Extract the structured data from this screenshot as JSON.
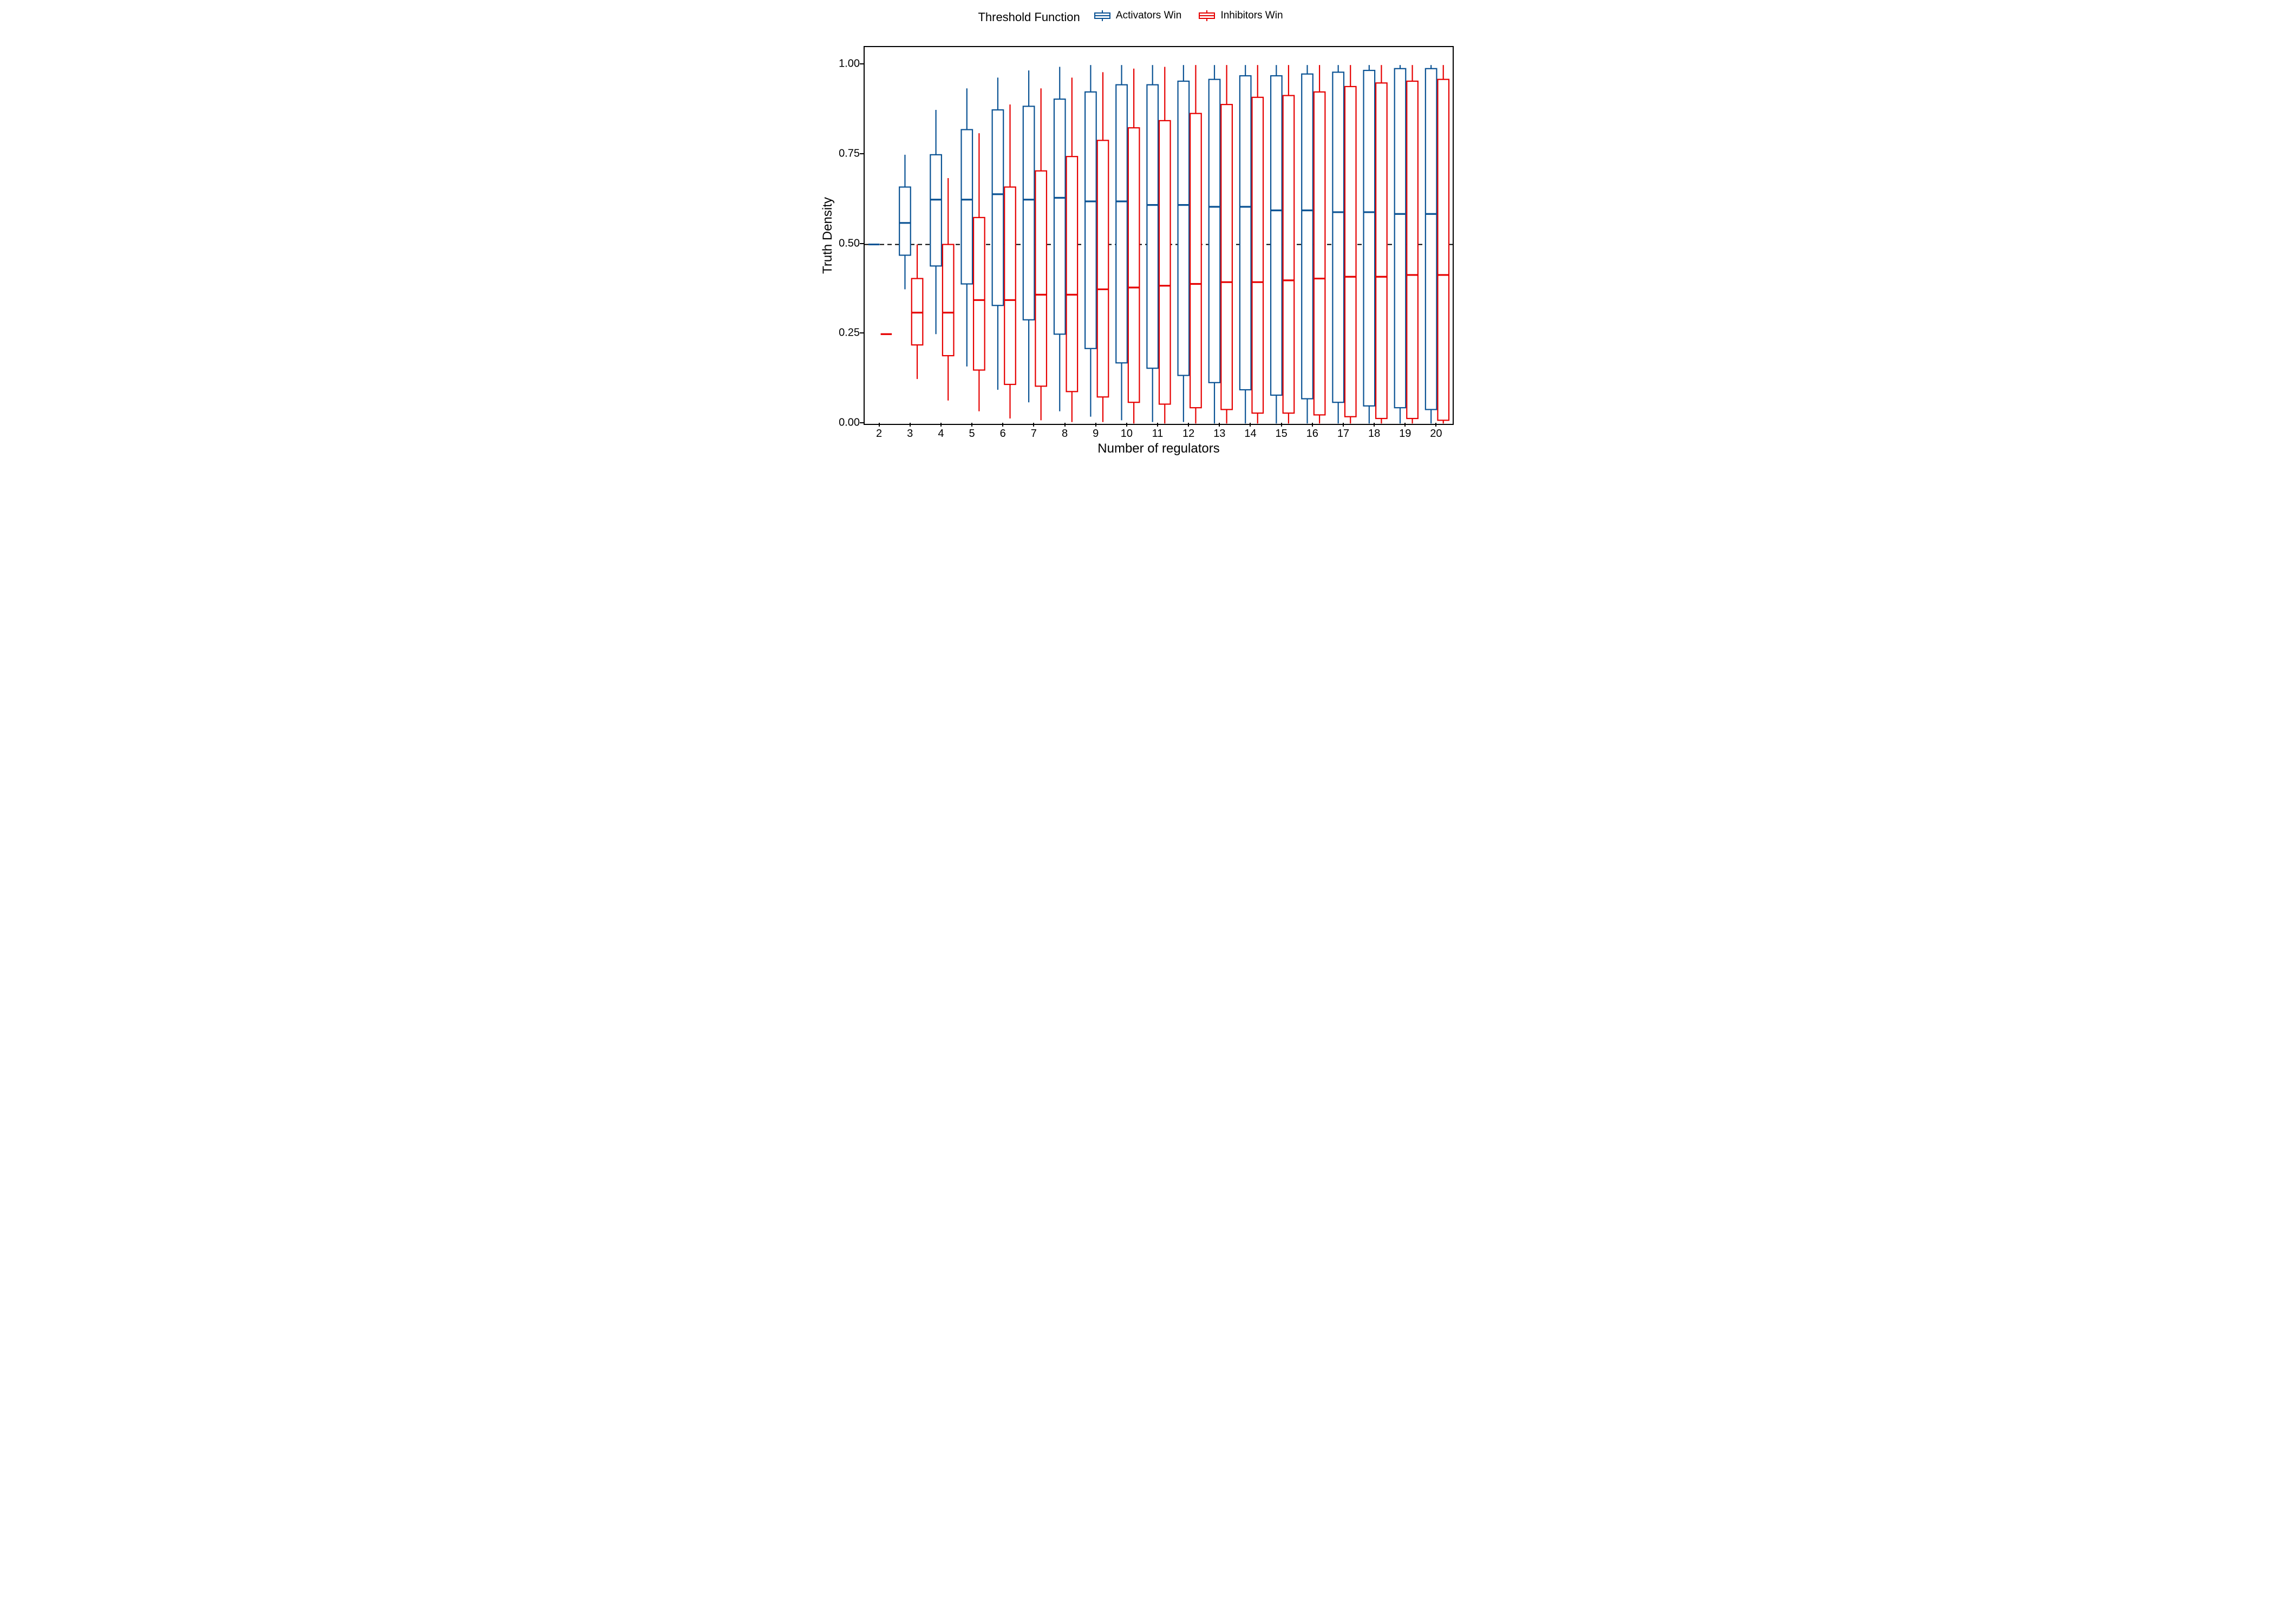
{
  "legend": {
    "title": "Threshold Function",
    "items": [
      {
        "label": "Activators Win",
        "color": "#0b5394"
      },
      {
        "label": "Inhibitors Win",
        "color": "#e60000"
      }
    ]
  },
  "axes": {
    "xlabel": "Number of regulators",
    "ylabel": "Truth Density",
    "ylim": [
      0,
      1.05
    ],
    "yticks": [
      0.0,
      0.25,
      0.5,
      0.75,
      1.0
    ],
    "categories": [
      2,
      3,
      4,
      5,
      6,
      7,
      8,
      9,
      10,
      11,
      12,
      13,
      14,
      15,
      16,
      17,
      18,
      19,
      20
    ],
    "hline": 0.5
  },
  "chart_data": {
    "type": "boxplot-grouped",
    "title": "",
    "xlabel": "Number of regulators",
    "ylabel": "Truth Density",
    "ylim": [
      0,
      1.05
    ],
    "hline": 0.5,
    "categories": [
      2,
      3,
      4,
      5,
      6,
      7,
      8,
      9,
      10,
      11,
      12,
      13,
      14,
      15,
      16,
      17,
      18,
      19,
      20
    ],
    "series": [
      {
        "name": "Activators Win",
        "color": "#0b5394",
        "boxes": [
          {
            "cat": 2,
            "whisker_low": 0.5,
            "q1": 0.5,
            "median": 0.5,
            "q3": 0.5,
            "whisker_high": 0.5
          },
          {
            "cat": 3,
            "whisker_low": 0.375,
            "q1": 0.47,
            "median": 0.56,
            "q3": 0.66,
            "whisker_high": 0.75
          },
          {
            "cat": 4,
            "whisker_low": 0.25,
            "q1": 0.44,
            "median": 0.625,
            "q3": 0.75,
            "whisker_high": 0.875
          },
          {
            "cat": 5,
            "whisker_low": 0.16,
            "q1": 0.39,
            "median": 0.625,
            "q3": 0.82,
            "whisker_high": 0.935
          },
          {
            "cat": 6,
            "whisker_low": 0.095,
            "q1": 0.33,
            "median": 0.64,
            "q3": 0.875,
            "whisker_high": 0.965
          },
          {
            "cat": 7,
            "whisker_low": 0.06,
            "q1": 0.29,
            "median": 0.625,
            "q3": 0.885,
            "whisker_high": 0.985
          },
          {
            "cat": 8,
            "whisker_low": 0.035,
            "q1": 0.25,
            "median": 0.63,
            "q3": 0.905,
            "whisker_high": 0.995
          },
          {
            "cat": 9,
            "whisker_low": 0.02,
            "q1": 0.21,
            "median": 0.62,
            "q3": 0.925,
            "whisker_high": 1.0
          },
          {
            "cat": 10,
            "whisker_low": 0.01,
            "q1": 0.17,
            "median": 0.62,
            "q3": 0.945,
            "whisker_high": 1.0
          },
          {
            "cat": 11,
            "whisker_low": 0.005,
            "q1": 0.155,
            "median": 0.61,
            "q3": 0.945,
            "whisker_high": 1.0
          },
          {
            "cat": 12,
            "whisker_low": 0.005,
            "q1": 0.135,
            "median": 0.61,
            "q3": 0.955,
            "whisker_high": 1.0
          },
          {
            "cat": 13,
            "whisker_low": 0.001,
            "q1": 0.115,
            "median": 0.605,
            "q3": 0.96,
            "whisker_high": 1.0
          },
          {
            "cat": 14,
            "whisker_low": 0.001,
            "q1": 0.095,
            "median": 0.605,
            "q3": 0.97,
            "whisker_high": 1.0
          },
          {
            "cat": 15,
            "whisker_low": 0.001,
            "q1": 0.08,
            "median": 0.595,
            "q3": 0.97,
            "whisker_high": 1.0
          },
          {
            "cat": 16,
            "whisker_low": 0.001,
            "q1": 0.07,
            "median": 0.595,
            "q3": 0.975,
            "whisker_high": 1.0
          },
          {
            "cat": 17,
            "whisker_low": 0.001,
            "q1": 0.06,
            "median": 0.59,
            "q3": 0.98,
            "whisker_high": 1.0
          },
          {
            "cat": 18,
            "whisker_low": 0.001,
            "q1": 0.05,
            "median": 0.59,
            "q3": 0.985,
            "whisker_high": 1.0
          },
          {
            "cat": 19,
            "whisker_low": 0.001,
            "q1": 0.045,
            "median": 0.585,
            "q3": 0.99,
            "whisker_high": 1.0
          },
          {
            "cat": 20,
            "whisker_low": 0.001,
            "q1": 0.04,
            "median": 0.585,
            "q3": 0.99,
            "whisker_high": 1.0
          }
        ]
      },
      {
        "name": "Inhibitors Win",
        "color": "#e60000",
        "boxes": [
          {
            "cat": 2,
            "whisker_low": 0.25,
            "q1": 0.25,
            "median": 0.25,
            "q3": 0.25,
            "whisker_high": 0.25
          },
          {
            "cat": 3,
            "whisker_low": 0.125,
            "q1": 0.22,
            "median": 0.31,
            "q3": 0.405,
            "whisker_high": 0.5
          },
          {
            "cat": 4,
            "whisker_low": 0.065,
            "q1": 0.19,
            "median": 0.31,
            "q3": 0.5,
            "whisker_high": 0.685
          },
          {
            "cat": 5,
            "whisker_low": 0.035,
            "q1": 0.15,
            "median": 0.345,
            "q3": 0.575,
            "whisker_high": 0.81
          },
          {
            "cat": 6,
            "whisker_low": 0.015,
            "q1": 0.11,
            "median": 0.345,
            "q3": 0.66,
            "whisker_high": 0.89
          },
          {
            "cat": 7,
            "whisker_low": 0.01,
            "q1": 0.105,
            "median": 0.36,
            "q3": 0.705,
            "whisker_high": 0.935
          },
          {
            "cat": 8,
            "whisker_low": 0.005,
            "q1": 0.09,
            "median": 0.36,
            "q3": 0.745,
            "whisker_high": 0.965
          },
          {
            "cat": 9,
            "whisker_low": 0.005,
            "q1": 0.075,
            "median": 0.375,
            "q3": 0.79,
            "whisker_high": 0.98
          },
          {
            "cat": 10,
            "whisker_low": 0.001,
            "q1": 0.06,
            "median": 0.38,
            "q3": 0.825,
            "whisker_high": 0.99
          },
          {
            "cat": 11,
            "whisker_low": 0.001,
            "q1": 0.055,
            "median": 0.385,
            "q3": 0.845,
            "whisker_high": 0.995
          },
          {
            "cat": 12,
            "whisker_low": 0.001,
            "q1": 0.045,
            "median": 0.39,
            "q3": 0.865,
            "whisker_high": 1.0
          },
          {
            "cat": 13,
            "whisker_low": 0.001,
            "q1": 0.04,
            "median": 0.395,
            "q3": 0.89,
            "whisker_high": 1.0
          },
          {
            "cat": 14,
            "whisker_low": 0.001,
            "q1": 0.03,
            "median": 0.395,
            "q3": 0.91,
            "whisker_high": 1.0
          },
          {
            "cat": 15,
            "whisker_low": 0.001,
            "q1": 0.03,
            "median": 0.4,
            "q3": 0.915,
            "whisker_high": 1.0
          },
          {
            "cat": 16,
            "whisker_low": 0.001,
            "q1": 0.025,
            "median": 0.405,
            "q3": 0.925,
            "whisker_high": 1.0
          },
          {
            "cat": 17,
            "whisker_low": 0.001,
            "q1": 0.02,
            "median": 0.41,
            "q3": 0.94,
            "whisker_high": 1.0
          },
          {
            "cat": 18,
            "whisker_low": 0.001,
            "q1": 0.015,
            "median": 0.41,
            "q3": 0.95,
            "whisker_high": 1.0
          },
          {
            "cat": 19,
            "whisker_low": 0.001,
            "q1": 0.015,
            "median": 0.415,
            "q3": 0.955,
            "whisker_high": 1.0
          },
          {
            "cat": 20,
            "whisker_low": 0.001,
            "q1": 0.01,
            "median": 0.415,
            "q3": 0.96,
            "whisker_high": 1.0
          }
        ]
      }
    ]
  }
}
